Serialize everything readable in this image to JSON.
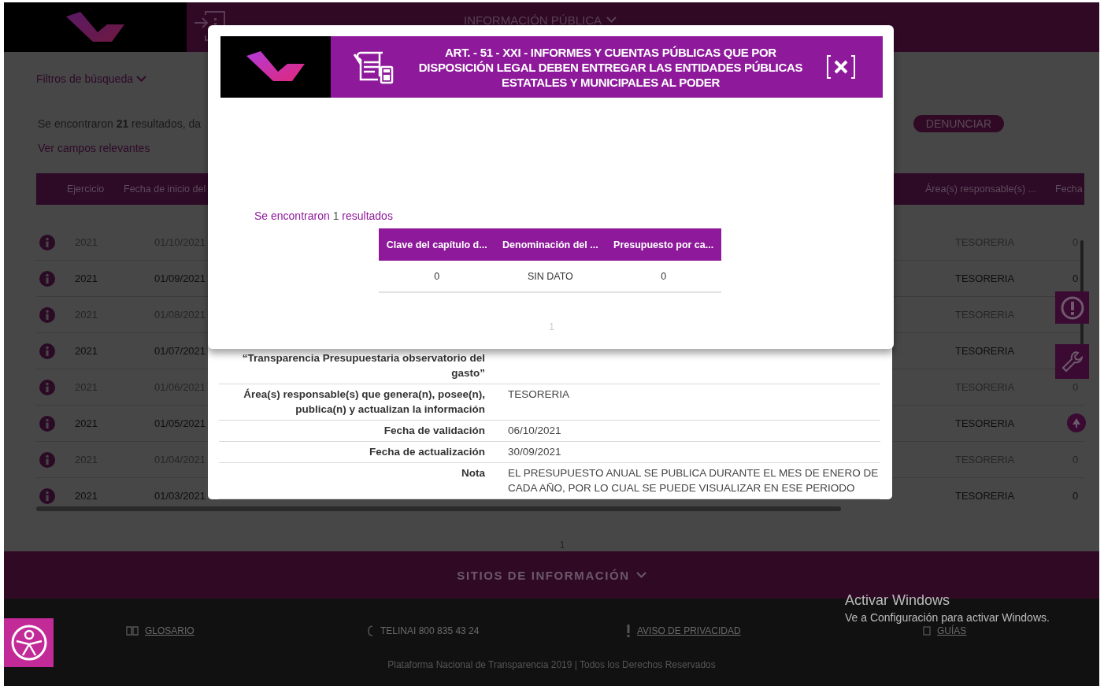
{
  "header": {
    "nav_label": "INFORMACIÓN PÚBLICA"
  },
  "filters": {
    "label": "Filtros de búsqueda"
  },
  "results_summary": "Se encontraron **21** resultados, da",
  "report_button": "DENUNCIAR",
  "relevant_fields_link": "Ver campos relevantes",
  "table": {
    "columns": [
      "Ejercicio",
      "Fecha de inicio del",
      "Área(s) responsable(s) ...",
      "Fecha"
    ],
    "rows": [
      {
        "ejercicio": "2021",
        "fecha_inicio": "01/10/2021",
        "area": "TESORERIA",
        "column_last": "0"
      },
      {
        "ejercicio": "2021",
        "fecha_inicio": "01/09/2021",
        "area": "TESORERIA",
        "column_last": "0"
      },
      {
        "ejercicio": "2021",
        "fecha_inicio": "01/08/2021",
        "area": "TESORERIA"
      },
      {
        "ejercicio": "2021",
        "fecha_inicio": "01/07/2021",
        "area": "TESORERIA"
      },
      {
        "ejercicio": "2021",
        "fecha_inicio": "01/06/2021",
        "area": "TESORERIA",
        "column_last": "0"
      },
      {
        "ejercicio": "2021",
        "fecha_inicio": "01/05/2021",
        "area": "TESORERIA"
      },
      {
        "ejercicio": "2021",
        "fecha_inicio": "01/04/2021",
        "area": "TESORERIA",
        "column_last": "0"
      },
      {
        "ejercicio": "2021",
        "fecha_inicio": "01/03/2021",
        "area": "TESORERIA",
        "column_last": "0"
      }
    ]
  },
  "pagination": [
    "1"
  ],
  "footer": {
    "section_toggle": "SITIOS DE INFORMACIÓN",
    "links": [
      {
        "label": "GLOSARIO",
        "kind": "link"
      },
      {
        "label": "TELINAI 800 835 43 24",
        "kind": "text"
      },
      {
        "label": "AVISO DE PRIVACIDAD",
        "kind": "link"
      },
      {
        "label": "GUÍAS",
        "kind": "link"
      }
    ],
    "copyright": "Plataforma Nacional de Transparencia 2019 | Todos los Derechos Reservados"
  },
  "detail_panel": {
    "rows": [
      {
        "label": "“Transparencia Presupuestaria observatorio del gasto”"
      },
      {
        "label": "Área(s) responsable(s) que genera(n), posee(n), publica(n) y actualizan la información",
        "value": "TESORERIA"
      },
      {
        "label": "Fecha de validación",
        "value": "06/10/2021"
      },
      {
        "label": "Fecha de actualización",
        "value": "30/09/2021"
      },
      {
        "label": "Nota",
        "value": "EL PRESUPUESTO ANUAL SE PUBLICA DURANTE EL MES DE ENERO DE CADA AÑO, POR LO CUAL SE PUEDE VISUALIZAR EN ESE PERIODO"
      }
    ]
  },
  "modal": {
    "title": "ART. - 51 - XXI - INFORMES Y CUENTAS PÚBLICAS QUE POR DISPOSICIÓN LEGAL DEBEN ENTREGAR LAS ENTIDADES PÚBLICAS ESTATALES Y MUNICIPALES AL PODER",
    "results_summary": "Se encontraron **1** resultados",
    "table": {
      "columns": [
        "Clave del capítulo d...",
        "Denominación del ...",
        "Presupuesto por ca..."
      ],
      "rows": [
        [
          "0",
          "SIN DATO",
          "0"
        ]
      ]
    },
    "pagination": [
      "1"
    ]
  },
  "os_notice": {
    "title": "Activar Windows",
    "message": "Ve a Configuración para activar Windows."
  }
}
